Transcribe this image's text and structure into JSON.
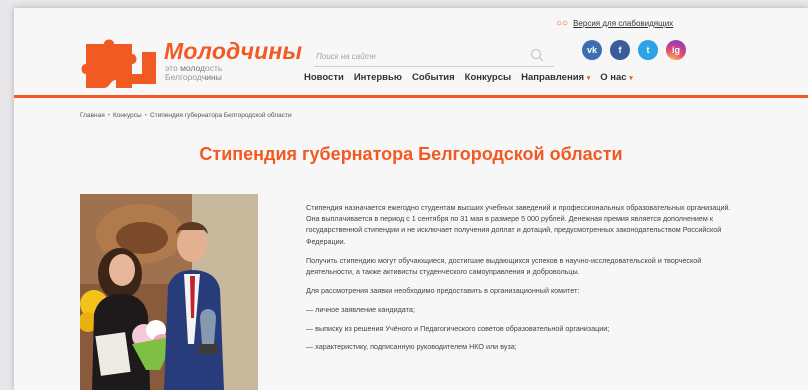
{
  "header": {
    "logo_title": "Молодчины",
    "logo_tagline": [
      "это",
      "молод",
      "ость",
      "Белгород",
      "чины"
    ],
    "accessibility_link": "Версия для слабовидящих",
    "search_placeholder": "Поиск на сайте",
    "social": [
      {
        "name": "vk-icon",
        "label": "vk"
      },
      {
        "name": "facebook-icon",
        "label": "f"
      },
      {
        "name": "twitter-icon",
        "label": "t"
      },
      {
        "name": "instagram-icon",
        "label": "ig"
      }
    ],
    "nav": [
      "Новости",
      "Интервью",
      "События",
      "Конкурсы",
      "Направления",
      "О нас"
    ],
    "brand_color": "#f15a22"
  },
  "breadcrumb": [
    "Главная",
    "Конкурсы",
    "Стипендия губернатора Белгородской области"
  ],
  "page": {
    "title": "Стипендия губернатора Белгородской области",
    "paragraphs": [
      "Стипендия назначается ежегодно студентам высших учебных заведений и профессиональных образовательных организаций. Она выплачивается в период с 1 сентября по 31 мая в размере 5 000 рублей. Денежная премия является дополнением к государственной стипендии и не исключает получения доплат и дотаций, предусмотренных законодательством Российской Федерации.",
      "Получить стипендию могут обучающиеся, достигшие выдающихся успехов в научно-исследовательской и творческой деятельности, а также активисты студенческого самоуправления и добровольцы.",
      "Для рассмотрения заявки необходимо предоставить в организационный комитет:"
    ],
    "list": [
      "— личное заявление кандидата;",
      "— выписку из решения Учёного и Педагогического советов образовательной организации;",
      "— характеристику, подписанную руководителем НКО или вуза;"
    ]
  }
}
